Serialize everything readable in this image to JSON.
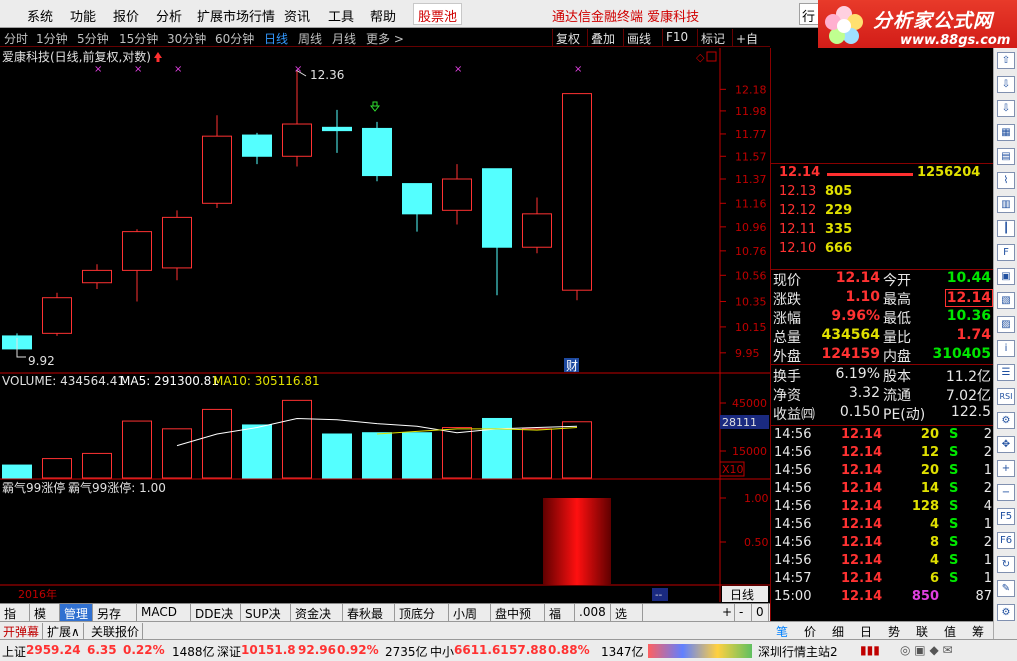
{
  "menu": {
    "items": [
      "系统",
      "功能",
      "报价",
      "分析",
      "扩展市场行情",
      "资讯",
      "工具",
      "帮助"
    ],
    "stock_pool": "股票池",
    "app_title": "通达信金融终端   爱康科技",
    "hangqing": "行"
  },
  "logo": {
    "name": "分析家公式网",
    "url": "www.88gs.com"
  },
  "periods": {
    "items": [
      "分时",
      "1分钟",
      "5分钟",
      "15分钟",
      "30分钟",
      "60分钟",
      "日线",
      "周线",
      "月线",
      "更多 >"
    ],
    "active": "日线"
  },
  "toolbar": {
    "fuquan": "复权",
    "diejia": "叠加",
    "huaxian": "画线",
    "f10": "F10",
    "biaoji": "标记",
    "zixuan": "+自选"
  },
  "chart": {
    "header": "爱康科技(日线,前复权,对数)",
    "high_label": "12.36",
    "low_label": "9.92",
    "cai_label": "财",
    "year_label": "2016年",
    "period_label": "日线",
    "price_axis": [
      "12.18",
      "11.98",
      "11.77",
      "11.57",
      "11.37",
      "11.16",
      "10.96",
      "10.76",
      "10.56",
      "10.35",
      "10.15",
      "9.95"
    ],
    "volume_header": {
      "vol": "VOLUME: 434564.41",
      "ma5": "MA5: 291300.81",
      "ma10": "MA10: 305116.81"
    },
    "volume_axis": [
      "45000",
      "15000"
    ],
    "volume_cursor": "28111",
    "volume_unit": "X10",
    "indicator_header": {
      "a": "霸气99涨停",
      "b": "霸气99涨停: 1.00"
    },
    "indicator_axis": [
      "1.00",
      "0.50"
    ],
    "colors": {
      "up": "#ff3232",
      "down": "#54ffff",
      "ma5": "#ffffff",
      "ma10": "#e0e000",
      "axis": "#c00000"
    }
  },
  "chart_data": {
    "type": "candlestick",
    "candles": [
      {
        "open": 9.98,
        "close": 10.08,
        "high": 10.1,
        "low": 9.92,
        "volume": 100000,
        "dir": "down"
      },
      {
        "open": 10.1,
        "close": 10.38,
        "high": 10.42,
        "low": 10.08,
        "volume": 150000,
        "dir": "up"
      },
      {
        "open": 10.5,
        "close": 10.6,
        "high": 10.65,
        "low": 10.45,
        "volume": 190000,
        "dir": "up"
      },
      {
        "open": 10.6,
        "close": 10.92,
        "high": 10.94,
        "low": 10.35,
        "volume": 440000,
        "dir": "up"
      },
      {
        "open": 10.62,
        "close": 11.04,
        "high": 11.1,
        "low": 10.52,
        "volume": 380000,
        "dir": "up"
      },
      {
        "open": 11.16,
        "close": 11.75,
        "high": 11.94,
        "low": 11.12,
        "volume": 530000,
        "dir": "up"
      },
      {
        "open": 11.76,
        "close": 11.57,
        "high": 11.78,
        "low": 11.5,
        "volume": 410000,
        "dir": "down"
      },
      {
        "open": 11.57,
        "close": 11.86,
        "high": 12.36,
        "low": 11.48,
        "volume": 600000,
        "dir": "up"
      },
      {
        "open": 11.83,
        "close": 11.8,
        "high": 11.99,
        "low": 11.6,
        "volume": 340000,
        "dir": "down"
      },
      {
        "open": 11.82,
        "close": 11.4,
        "high": 11.88,
        "low": 11.35,
        "volume": 350000,
        "dir": "down"
      },
      {
        "open": 11.33,
        "close": 11.07,
        "high": 11.33,
        "low": 10.92,
        "volume": 350000,
        "dir": "down"
      },
      {
        "open": 11.1,
        "close": 11.37,
        "high": 11.5,
        "low": 10.98,
        "volume": 390000,
        "dir": "up"
      },
      {
        "open": 11.46,
        "close": 10.79,
        "high": 11.46,
        "low": 10.4,
        "volume": 460000,
        "dir": "down"
      },
      {
        "open": 10.79,
        "close": 11.07,
        "high": 11.21,
        "low": 10.74,
        "volume": 380000,
        "dir": "up"
      },
      {
        "open": 10.44,
        "close": 12.14,
        "high": 12.14,
        "low": 10.36,
        "volume": 434564,
        "dir": "up"
      }
    ],
    "ma5": [
      null,
      null,
      null,
      null,
      250000,
      340000,
      390000,
      460000,
      450000,
      420000,
      400000,
      350000,
      380000,
      390000,
      400000
    ],
    "ma10": [
      null,
      null,
      null,
      null,
      null,
      null,
      null,
      null,
      null,
      340000,
      360000,
      380000,
      380000,
      370000,
      390000
    ],
    "indicator": [
      0,
      0,
      0,
      0,
      0,
      0,
      0,
      0,
      0,
      0,
      0,
      0,
      0,
      0,
      1
    ],
    "price_range": [
      9.85,
      12.4
    ],
    "volume_range": [
      0,
      680000
    ]
  },
  "orderbook": {
    "sell1": {
      "price": "12.14",
      "vol": "1256204"
    },
    "buys": [
      {
        "label": "12.13",
        "vol": "805"
      },
      {
        "label": "12.12",
        "vol": "229"
      },
      {
        "label": "12.11",
        "vol": "335"
      },
      {
        "label": "12.10",
        "vol": "666"
      }
    ]
  },
  "quote": [
    {
      "k1": "现价",
      "v1": "12.14",
      "c1": "red",
      "k2": "今开",
      "v2": "10.44",
      "c2": "green"
    },
    {
      "k1": "涨跌",
      "v1": "1.10",
      "c1": "red",
      "k2": "最高",
      "v2": "12.14",
      "c2": "redbox"
    },
    {
      "k1": "涨幅",
      "v1": "9.96%",
      "c1": "red",
      "k2": "最低",
      "v2": "10.36",
      "c2": "green"
    },
    {
      "k1": "总量",
      "v1": "434564",
      "c1": "yellow",
      "k2": "量比",
      "v2": "1.74",
      "c2": "red"
    },
    {
      "k1": "外盘",
      "v1": "124159",
      "c1": "red",
      "k2": "内盘",
      "v2": "310405",
      "c2": "green"
    }
  ],
  "quote2": [
    {
      "k1": "换手",
      "v1": "6.19%",
      "k2": "股本",
      "v2": "11.2亿"
    },
    {
      "k1": "净资",
      "v1": "3.32",
      "k2": "流通",
      "v2": "7.02亿"
    },
    {
      "k1": "收益㈣",
      "v1": "0.150",
      "k2": "PE(动)",
      "v2": "122.5"
    }
  ],
  "ticks": [
    {
      "time": "14:56",
      "price": "12.14",
      "vol": "20",
      "bs": "S",
      "n": "2"
    },
    {
      "time": "14:56",
      "price": "12.14",
      "vol": "12",
      "bs": "S",
      "n": "2"
    },
    {
      "time": "14:56",
      "price": "12.14",
      "vol": "20",
      "bs": "S",
      "n": "1"
    },
    {
      "time": "14:56",
      "price": "12.14",
      "vol": "14",
      "bs": "S",
      "n": "2"
    },
    {
      "time": "14:56",
      "price": "12.14",
      "vol": "128",
      "bs": "S",
      "n": "4"
    },
    {
      "time": "14:56",
      "price": "12.14",
      "vol": "4",
      "bs": "S",
      "n": "1"
    },
    {
      "time": "14:56",
      "price": "12.14",
      "vol": "8",
      "bs": "S",
      "n": "2"
    },
    {
      "time": "14:56",
      "price": "12.14",
      "vol": "4",
      "bs": "S",
      "n": "1"
    },
    {
      "time": "14:57",
      "price": "12.14",
      "vol": "6",
      "bs": "S",
      "n": "1"
    },
    {
      "time": "15:00",
      "price": "12.14",
      "vol": "850",
      "bs": "",
      "n": "87"
    }
  ],
  "tabs": {
    "items": [
      "指标",
      "模板",
      "管理",
      "另存为",
      "MACD基本",
      "DDE决策",
      "SUP决策",
      "资金决策",
      "春秋最牛",
      "顶底分析",
      "小周期",
      "盘中预警",
      "福豪",
      ".008",
      "选股"
    ],
    "active": "管理",
    "right": [
      "+",
      "-",
      "0"
    ]
  },
  "subtabs": [
    "开弹幕",
    "扩展∧",
    "关联报价"
  ],
  "rp_tabs": {
    "items": [
      "笔",
      "价",
      "细",
      "日",
      "势",
      "联",
      "值",
      "筹"
    ],
    "active": "笔"
  },
  "status": {
    "sh_label": "上证",
    "sh_val": "2959.24",
    "sh_chg": "6.35",
    "sh_pct": "0.22%",
    "sh_amt": "1488亿",
    "sz_label": "深证",
    "sz_val": "10151.8",
    "sz_chg": "92.96",
    "sz_pct": "0.92%",
    "sz_amt": "2735亿",
    "zx_label": "中小",
    "zx_val": "6611.61",
    "zx_chg": "57.88",
    "zx_pct": "0.88%",
    "zx_amt": "1347亿",
    "server": "深圳行情主站2"
  },
  "side_icons": [
    "up-arrow-icon",
    "down-arrow-icon",
    "import-icon",
    "grid-icon",
    "kline-icon",
    "trend-icon",
    "bar-icon",
    "candle-icon",
    "f10-icon",
    "report-icon",
    "block-icon",
    "rank-icon",
    "info-icon",
    "news-icon",
    "rsi-icon",
    "gear-icon",
    "move-icon",
    "zoom-in-icon",
    "zoom-out-icon",
    "f5-icon",
    "f6-icon",
    "refresh-icon",
    "tool-icon",
    "settings-icon"
  ]
}
